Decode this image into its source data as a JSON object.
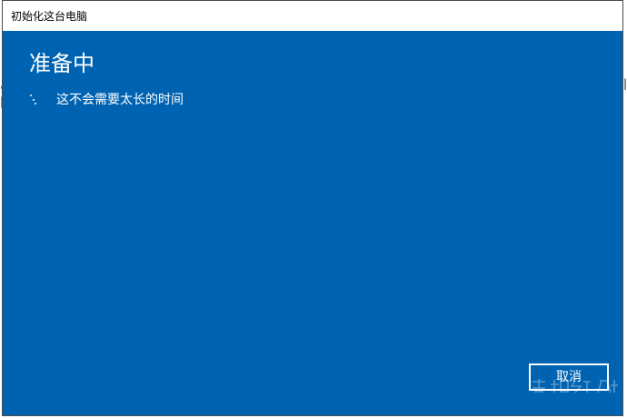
{
  "window": {
    "title": "初始化这台电脑"
  },
  "main": {
    "heading": "准备中",
    "status_text": "这不会需要太长的时间",
    "spinner_icon": "loading-dots-icon"
  },
  "actions": {
    "cancel_label": "取消"
  },
  "colors": {
    "accent": "#0063b1",
    "text_on_accent": "#ffffff",
    "titlebar_bg": "#ffffff"
  }
}
